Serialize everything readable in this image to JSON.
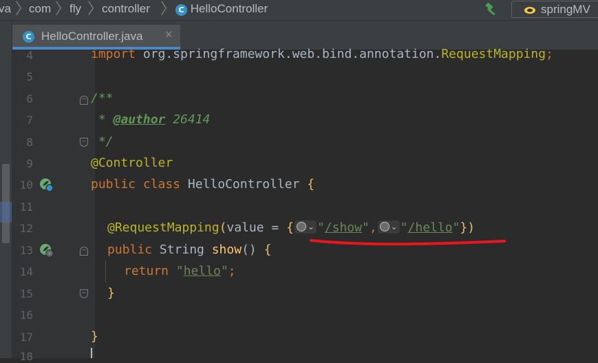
{
  "breadcrumb": {
    "items": [
      "va",
      "com",
      "fly",
      "controller",
      "HelloController"
    ],
    "class_badge": "C"
  },
  "toolbar": {
    "build_icon": "hammer-icon",
    "run_config_label": "springMV"
  },
  "editor_tabs": [
    {
      "label": "HelloController.java",
      "active": true,
      "close": "×"
    }
  ],
  "line_numbers": [
    "4",
    "5",
    "6",
    "7",
    "8",
    "9",
    "10",
    "11",
    "12",
    "13",
    "14",
    "15",
    "16",
    "17",
    "18"
  ],
  "code": {
    "l4": [
      "import ",
      "org.springframework.web.bind.annotation.",
      "RequestMapping",
      ";"
    ],
    "l6": "/**",
    "l7": [
      " * ",
      "@author",
      " 26414"
    ],
    "l8": " */",
    "l9": "@Controller",
    "l10": [
      "public ",
      "class ",
      "HelloController ",
      "{"
    ],
    "l12": [
      "@RequestMapping",
      "(",
      "value",
      " = ",
      "{",
      "\"",
      "/show",
      "\"",
      ",",
      "\"",
      "/hello",
      "\"",
      "}",
      ")"
    ],
    "l13": [
      "public ",
      "String ",
      "show",
      "() ",
      "{"
    ],
    "l14": [
      "return ",
      "\"",
      "hello",
      "\"",
      ";"
    ],
    "l15": "}",
    "l17": "}"
  },
  "colors": {
    "background": "#2b2b2b",
    "keyword": "#cc7832",
    "annotation": "#bbb529",
    "string": "#6a8759",
    "comment": "#629755",
    "method": "#ffc66d",
    "accent": "#4a88c7",
    "highlight_stroke": "#e8161f"
  }
}
